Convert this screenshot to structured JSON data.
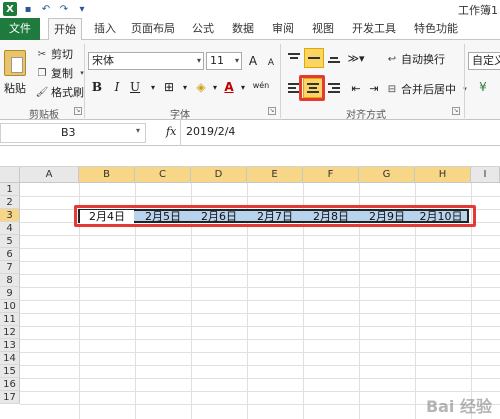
{
  "window": {
    "title": "工作簿1"
  },
  "tabs": [
    {
      "label": "文件",
      "key": "file"
    },
    {
      "label": "开始",
      "key": "home"
    },
    {
      "label": "插入",
      "key": "insert"
    },
    {
      "label": "页面布局",
      "key": "layout"
    },
    {
      "label": "公式",
      "key": "formulas"
    },
    {
      "label": "数据",
      "key": "data"
    },
    {
      "label": "审阅",
      "key": "review"
    },
    {
      "label": "视图",
      "key": "view"
    },
    {
      "label": "开发工具",
      "key": "developer"
    },
    {
      "label": "特色功能",
      "key": "features"
    }
  ],
  "clipboard": {
    "paste": "粘贴",
    "cut": "剪切",
    "copy": "复制",
    "format_painter": "格式刷",
    "group_label": "剪贴板"
  },
  "font": {
    "name": "宋体",
    "size": "11",
    "bold": "B",
    "italic": "I",
    "underline": "U",
    "grow": "A",
    "shrink": "A",
    "color_a": "A",
    "wen": "wén",
    "group_label": "字体"
  },
  "alignment": {
    "wrap_text": "自动换行",
    "merge_center": "合并后居中",
    "group_label": "对齐方式",
    "selected": "center"
  },
  "number": {
    "format": "自定义"
  },
  "formula_bar": {
    "name_box": "B3",
    "fx": "fx",
    "content": "2019/2/4"
  },
  "grid": {
    "columns": [
      "A",
      "B",
      "C",
      "D",
      "E",
      "F",
      "G",
      "H",
      "I"
    ],
    "rows": [
      "1",
      "2",
      "3",
      "4",
      "5",
      "6",
      "7",
      "8",
      "9",
      "10",
      "11",
      "12",
      "13",
      "14",
      "15",
      "16",
      "17"
    ],
    "row3_cells": [
      "2月4日",
      "2月5日",
      "2月6日",
      "2月7日",
      "2月8日",
      "2月9日",
      "2月10日"
    ]
  },
  "colors": {
    "accent_green": "#1f7a3d",
    "highlight_red": "#e53935",
    "selection_blue": "#b8d3ee",
    "selected_header": "#f7d688"
  },
  "watermark": "Bai 经验"
}
